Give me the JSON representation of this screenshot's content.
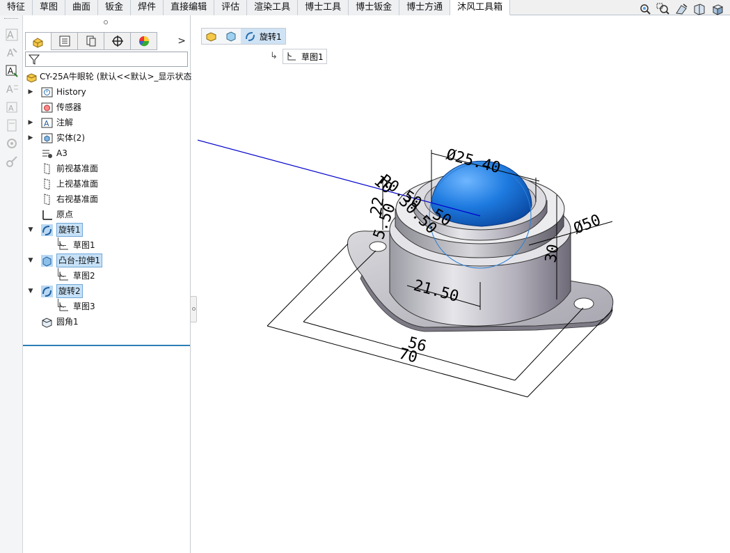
{
  "tabs": [
    "特征",
    "草图",
    "曲面",
    "钣金",
    "焊件",
    "直接编辑",
    "评估",
    "渲染工具",
    "博士工具",
    "博士钣金",
    "博士方通",
    "沐风工具箱"
  ],
  "active_tab": "沐风工具箱",
  "top_tools": [
    "zoom-to-fit-icon",
    "zoom-area-icon",
    "previous-view-icon",
    "section-view-icon",
    "view-orientation-icon"
  ],
  "left_toolbar_icons": [
    "smart-dimension-icon",
    "note-icon",
    "balloon-icon",
    "auto-balloon-icon",
    "surface-finish-icon",
    "weld-symbol-icon",
    "hole-callout-icon",
    "datum-icon"
  ],
  "panel_tabs": [
    "feature-manager-icon",
    "property-manager-icon",
    "configuration-manager-icon",
    "dimxpert-icon",
    "display-manager-icon"
  ],
  "tree": {
    "root": "CY-25A牛眼轮  (默认<<默认>_显示状态",
    "items": [
      {
        "label": "History",
        "icon": "history-icon",
        "expand": true,
        "indent": 0
      },
      {
        "label": "传感器",
        "icon": "sensor-icon",
        "expand": false,
        "indent": 0
      },
      {
        "label": "注解",
        "icon": "annotation-icon",
        "expand": true,
        "indent": 0
      },
      {
        "label": "实体(2)",
        "icon": "solid-bodies-icon",
        "expand": true,
        "indent": 0
      },
      {
        "label": "A3",
        "icon": "material-icon",
        "expand": false,
        "indent": 0
      },
      {
        "label": "前视基准面",
        "icon": "plane-icon",
        "expand": false,
        "indent": 0
      },
      {
        "label": "上视基准面",
        "icon": "plane-icon",
        "expand": false,
        "indent": 0
      },
      {
        "label": "右视基准面",
        "icon": "plane-icon",
        "expand": false,
        "indent": 0
      },
      {
        "label": "原点",
        "icon": "origin-icon",
        "expand": false,
        "indent": 0
      },
      {
        "label": "旋转1",
        "icon": "revolve-icon",
        "expand": "open",
        "indent": 0,
        "selected": true
      },
      {
        "label": "草图1",
        "icon": "sketch-icon",
        "expand": false,
        "indent": 1
      },
      {
        "label": "凸台-拉伸1",
        "icon": "extrude-icon",
        "expand": "open",
        "indent": 0,
        "selected": true
      },
      {
        "label": "草图2",
        "icon": "sketch-icon",
        "expand": false,
        "indent": 1
      },
      {
        "label": "旋转2",
        "icon": "revolve-icon",
        "expand": "open",
        "indent": 0,
        "selected": true
      },
      {
        "label": "草图3",
        "icon": "sketch-icon",
        "expand": false,
        "indent": 1
      },
      {
        "label": "圆角1",
        "icon": "fillet-icon",
        "expand": false,
        "indent": 0
      }
    ]
  },
  "breadcrumb": {
    "feature": "旋转1",
    "sketch": "草图1"
  },
  "dimensions": {
    "d_ball": "Ø25.40",
    "d_outer": "Ø50",
    "height": "30",
    "inner_height": "22",
    "width_inner": "21.50",
    "width_56": "56",
    "width_70": "70",
    "r_overlap": "R0.50",
    "small_a": "5.50",
    "small_b": "50",
    "small_c": "30.50",
    "overlap_text": "10"
  },
  "colors": {
    "ball": "#1e7be0",
    "body": "#b9b9c2",
    "dim": "#000000",
    "axis": "#0000cc",
    "selection": "#c6e1f7"
  }
}
